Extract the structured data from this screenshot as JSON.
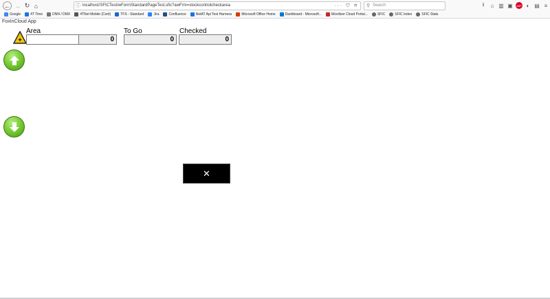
{
  "browser": {
    "url": "localhost/SFICTest/wFormStandardPageTest.sfic?awFrm=stockcontrolcheckarea",
    "search_placeholder": "Search",
    "url_actions": "··· ⛉ ☆",
    "icons": {
      "back": "back-icon",
      "forward": "forward-icon",
      "reload": "reload-icon",
      "home": "home-icon"
    }
  },
  "bookmarks": [
    {
      "label": "Google",
      "color": "#4285f4"
    },
    {
      "label": "4T Time",
      "color": "#1a73e8"
    },
    {
      "label": "DNN / DMX",
      "color": "#777777"
    },
    {
      "label": "4TNet Mobile (Cont)",
      "color": "#555555"
    },
    {
      "label": "TFS - Standard",
      "color": "#1e66c8"
    },
    {
      "label": "Jira",
      "color": "#2684ff"
    },
    {
      "label": "Confluence",
      "color": "#205081"
    },
    {
      "label": "NetAT Api Test Harness",
      "color": "#1a73e8"
    },
    {
      "label": "Microsoft Office Home",
      "color": "#d83b01"
    },
    {
      "label": "Dashboard - Microsoft...",
      "color": "#0078d4"
    },
    {
      "label": "Movilizer Cloud Portal...",
      "color": "#c1272d"
    },
    {
      "label": "SFIC",
      "color": "#666666"
    },
    {
      "label": "SFIC Index",
      "color": "#666666"
    },
    {
      "label": "SFIC Stats",
      "color": "#666666"
    }
  ],
  "app": {
    "title": "FoxInCloud App"
  },
  "form": {
    "area_label": "Area",
    "area_value": "",
    "area_count": "0",
    "to_go_label": "To Go",
    "to_go_value": "0",
    "checked_label": "Checked",
    "checked_value": "0"
  },
  "buttons": {
    "close_label": "✕",
    "up_icon": "arrow-up-icon",
    "down_icon": "arrow-down-icon"
  },
  "colors": {
    "arrow_green": "#7ccc36",
    "close_bg": "#000000",
    "warning_yellow": "#f5c400"
  }
}
